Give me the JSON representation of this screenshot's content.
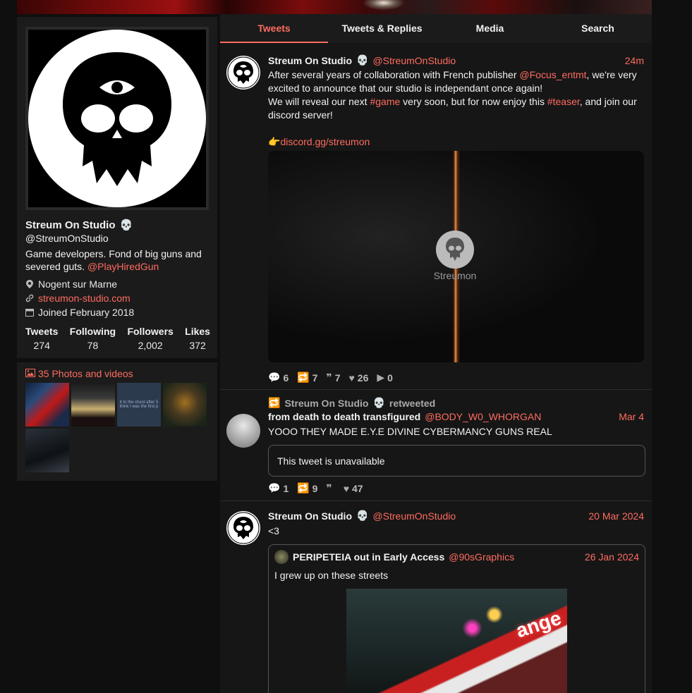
{
  "profile": {
    "name": "Streum On Studio",
    "handle": "@StreumOnStudio",
    "bio": "Game developers. Fond of big guns and severed guts.",
    "bio_link": "@PlayHiredGun",
    "location": "Nogent sur Marne",
    "website": "streumon-studio.com",
    "joined": "Joined February 2018",
    "stats": {
      "tweets_label": "Tweets",
      "tweets": "274",
      "following_label": "Following",
      "following": "78",
      "followers_label": "Followers",
      "followers": "2,002",
      "likes_label": "Likes",
      "likes": "372"
    }
  },
  "media": {
    "title": "35 Photos and videos",
    "thumb3_text": "it to the chest after 5 think I was the first p"
  },
  "tabs": [
    "Tweets",
    "Tweets & Replies",
    "Media",
    "Search"
  ],
  "tweets": [
    {
      "name": "Streum On Studio",
      "handle": "@StreumOnStudio",
      "date": "24m",
      "text1": "After several years of collaboration with French publisher ",
      "mention": "@Focus_entmt",
      "text2": ", we're very excited to announce that our studio is independant once again!",
      "text3": "We will reveal our next ",
      "hashtag1": "#game",
      "text4": " very soon, but for now enjoy this ",
      "hashtag2": "#teaser",
      "text5": ", and join our discord server!",
      "emoji": "👉",
      "link": "discord.gg/streumon",
      "video_logo": "Streumon",
      "stats": {
        "comments": "6",
        "retweets": "7",
        "quotes": "7",
        "likes": "26",
        "plays": "0"
      }
    },
    {
      "retweet_label": "Streum On Studio",
      "retweeted": "retweeted",
      "name": "from death to death transfigured",
      "handle": "@BODY_W0_WHORGAN",
      "date": "Mar 4",
      "text": "YOOO THEY MADE E.Y.E DIVINE CYBERMANCY GUNS REAL",
      "unavailable": "This tweet is unavailable",
      "stats": {
        "comments": "1",
        "retweets": "9",
        "quotes": "",
        "likes": "47"
      }
    },
    {
      "name": "Streum On Studio",
      "handle": "@StreumOnStudio",
      "date": "20 Mar 2024",
      "text": "<3",
      "quote": {
        "name": "PERIPETEIA out in Early Access",
        "handle": "@90sGraphics",
        "date": "26 Jan 2024",
        "text": "I grew up on these streets",
        "sign": "ange"
      }
    }
  ],
  "icons": {
    "skull": "skull-icon",
    "location": "map-pin-icon",
    "link": "link-icon",
    "calendar": "calendar-icon",
    "comment": "comment-icon",
    "retweet": "retweet-icon",
    "quote": "quote-icon",
    "heart": "heart-icon",
    "play": "play-icon"
  },
  "colors": {
    "accent": "#ff6c60",
    "background": "#0f0f0f",
    "panel": "#1b1b1b"
  }
}
